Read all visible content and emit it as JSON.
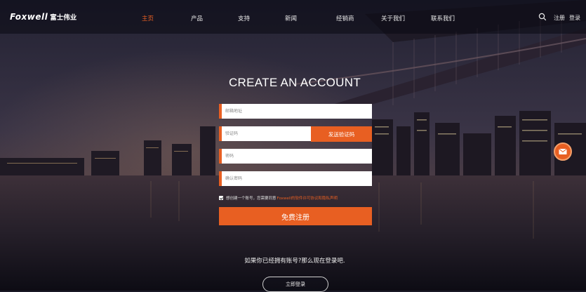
{
  "brand": {
    "logo_text": "Foxwell",
    "logo_cn": "富士伟业"
  },
  "nav": {
    "items": [
      {
        "label": "主页",
        "active": true
      },
      {
        "label": "产品",
        "active": false
      },
      {
        "label": "支持",
        "active": false
      },
      {
        "label": "新闻",
        "active": false
      },
      {
        "label": "经销商",
        "active": false
      },
      {
        "label": "关于我们",
        "active": false
      },
      {
        "label": "联系我们",
        "active": false
      }
    ],
    "register_label": "注册",
    "login_label": "登录"
  },
  "form": {
    "title": "CREATE AN ACCOUNT",
    "email_placeholder": "邮箱地址",
    "code_placeholder": "验证码",
    "send_code_label": "发送验证码",
    "password_placeholder": "密码",
    "confirm_password_placeholder": "确认密码",
    "agree_text": "想创建一个账号，您需要同意",
    "agree_link": "Foxwell的软件许可协议和隐私声明",
    "agree_checked": true,
    "submit_label": "免费注册"
  },
  "footer": {
    "have_account_text": "如果你已经拥有账号?那么现在登录吧.",
    "login_now_label": "立即登录"
  },
  "colors": {
    "accent": "#e85f22",
    "header_bg": "#0a0a12"
  }
}
